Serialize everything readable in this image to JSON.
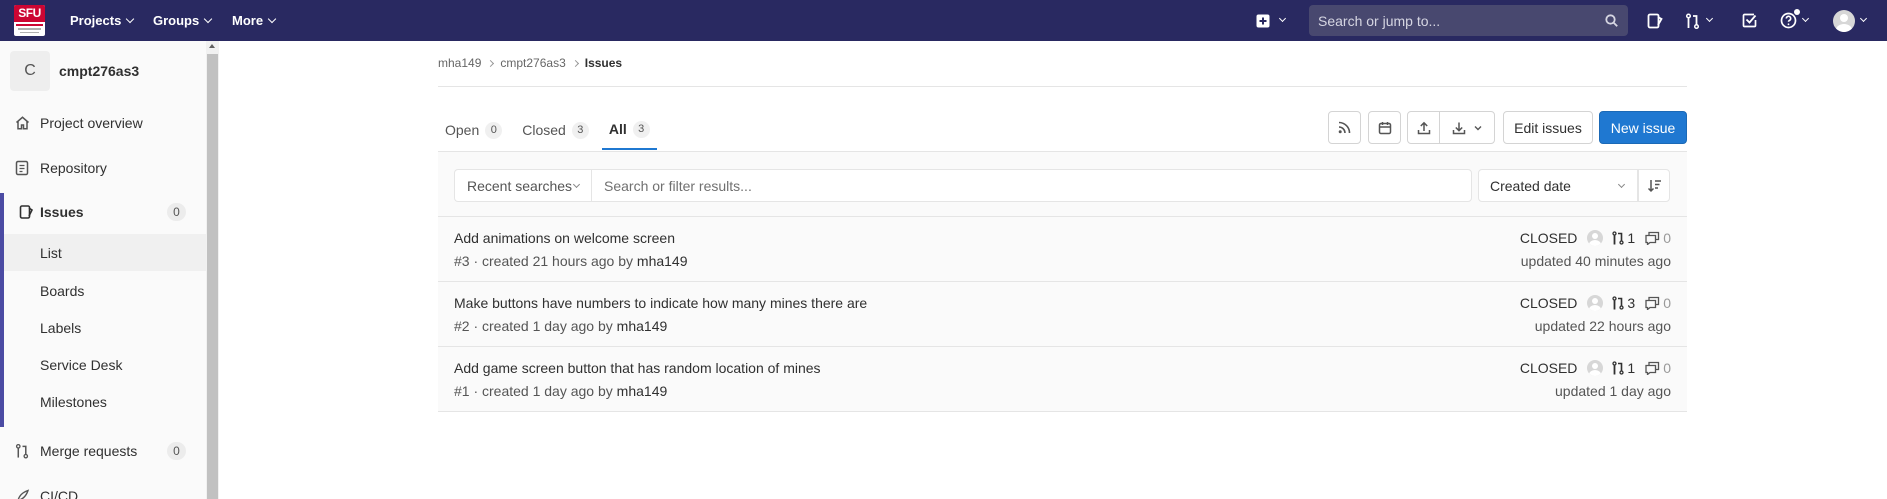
{
  "navbar": {
    "logo_text": "SFU",
    "menus": [
      "Projects",
      "Groups",
      "More"
    ],
    "search_placeholder": "Search or jump to..."
  },
  "sidebar": {
    "project_initial": "C",
    "project_name": "cmpt276as3",
    "items": [
      {
        "label": "Project overview",
        "icon": "home-icon"
      },
      {
        "label": "Repository",
        "icon": "doc-icon"
      },
      {
        "label": "Issues",
        "icon": "issues-icon",
        "count": "0"
      },
      {
        "label": "Merge requests",
        "icon": "merge-request-icon",
        "count": "0"
      },
      {
        "label": "CI/CD",
        "icon": "rocket-icon"
      }
    ],
    "issue_subitems": [
      "List",
      "Boards",
      "Labels",
      "Service Desk",
      "Milestones"
    ]
  },
  "breadcrumb": [
    "mha149",
    "cmpt276as3",
    "Issues"
  ],
  "tabs": [
    {
      "label": "Open",
      "count": "0"
    },
    {
      "label": "Closed",
      "count": "3"
    },
    {
      "label": "All",
      "count": "3"
    }
  ],
  "toolbar": {
    "edit_label": "Edit issues",
    "new_label": "New issue"
  },
  "filter": {
    "recent_label": "Recent searches",
    "placeholder": "Search or filter results...",
    "sort_label": "Created date"
  },
  "issues": [
    {
      "title": "Add animations on welcome screen",
      "ref": "#3 · created 21 hours ago by ",
      "author": "mha149",
      "state": "CLOSED",
      "mr_count": "1",
      "comments": "0",
      "updated": "updated 40 minutes ago"
    },
    {
      "title": "Make buttons have numbers to indicate how many mines there are",
      "ref": "#2 · created 1 day ago by ",
      "author": "mha149",
      "state": "CLOSED",
      "mr_count": "3",
      "comments": "0",
      "updated": "updated 22 hours ago"
    },
    {
      "title": "Add game screen button that has random location of mines",
      "ref": "#1 · created 1 day ago by ",
      "author": "mha149",
      "state": "CLOSED",
      "mr_count": "1",
      "comments": "0",
      "updated": "updated 1 day ago"
    }
  ],
  "colors": {
    "navbar": "#292961",
    "primary": "#1f78d1",
    "active_bar": "#4b4ba3"
  }
}
